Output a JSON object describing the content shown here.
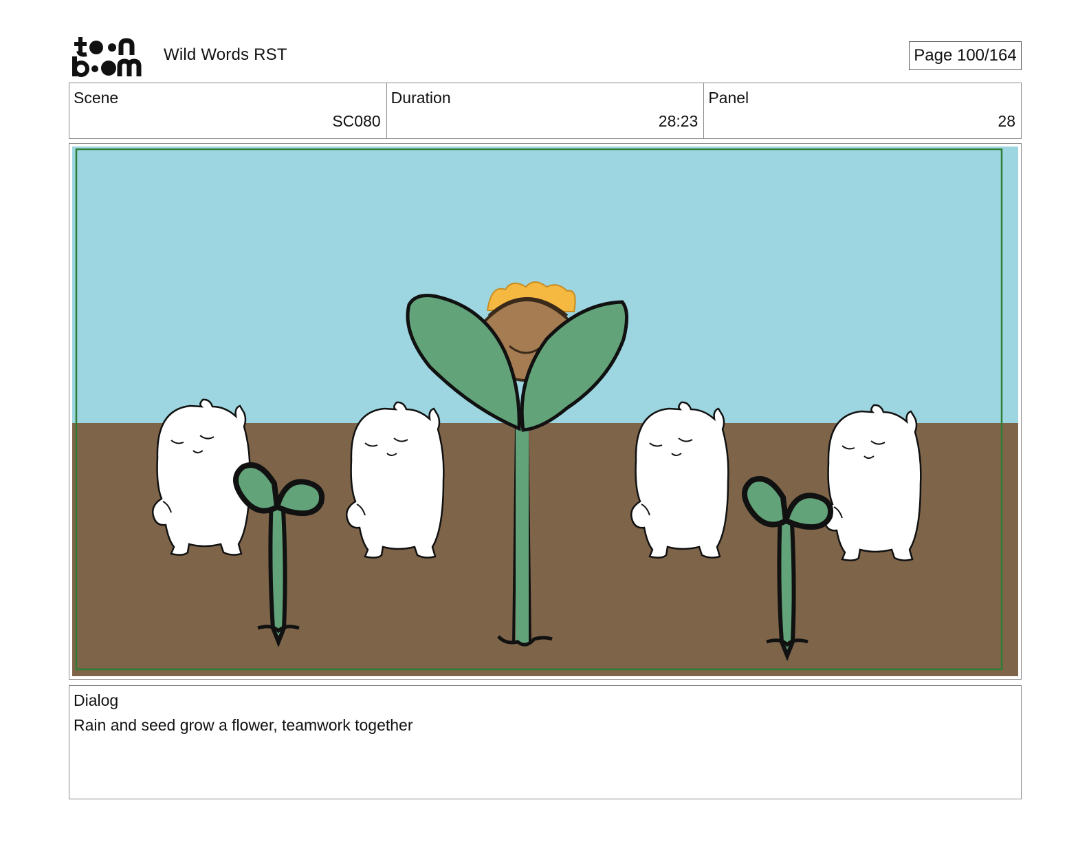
{
  "header": {
    "logo_text": "toon boom",
    "title": "Wild Words RST",
    "page": "Page 100/164"
  },
  "info": {
    "scene_label": "Scene",
    "scene_value": "SC080",
    "duration_label": "Duration",
    "duration_value": "28:23",
    "panel_label": "Panel",
    "panel_value": "28"
  },
  "dialog": {
    "label": "Dialog",
    "text": "Rain and seed grow a flower, teamwork together"
  },
  "colors": {
    "sky": "#9dd6e0",
    "ground": "#7e654a",
    "leaf": "#63a37a",
    "safe_frame": "#2e7d32",
    "petal": "#f5b942",
    "flower_center": "#a67c52"
  }
}
